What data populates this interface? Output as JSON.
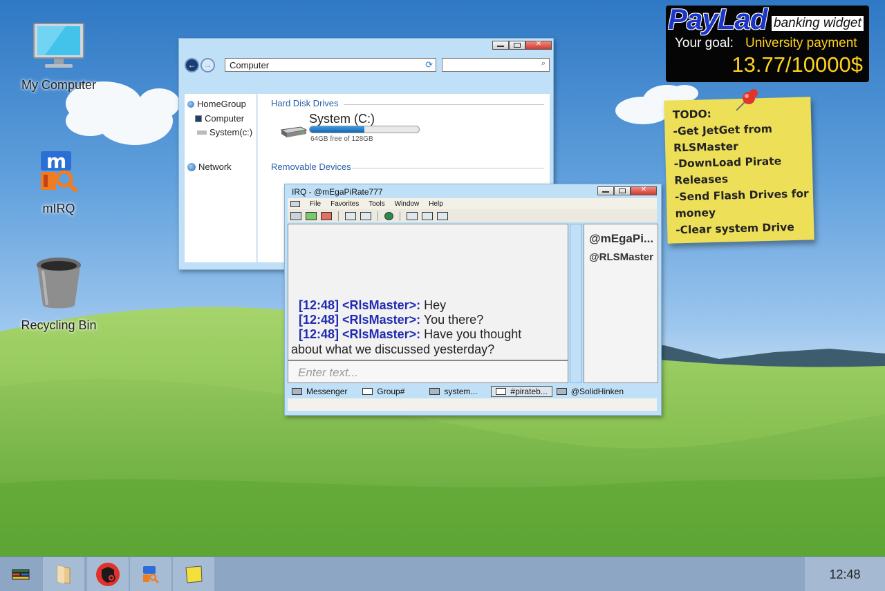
{
  "desktop": {
    "icons": [
      {
        "label": "My Computer",
        "icon": "monitor-icon"
      },
      {
        "label": "mIRQ",
        "icon": "mirq-app-icon"
      },
      {
        "label": "Recycling Bin",
        "icon": "trash-icon"
      }
    ]
  },
  "explorer": {
    "address": "Computer",
    "search_placeholder": "",
    "sidebar": [
      "HomeGroup",
      "Computer",
      "System(c:)",
      "Network"
    ],
    "sections": {
      "hard_disk": "Hard Disk Drives",
      "removable": "Removable Devices"
    },
    "drive": {
      "name": "System (C:)",
      "free_text": "64GB free of 128GB",
      "used_fraction": 0.5
    }
  },
  "chat": {
    "title": "IRQ - @mEgaPiRate777",
    "menu": [
      "File",
      "Favorites",
      "Tools",
      "Window",
      "Help"
    ],
    "messages": [
      {
        "time": "[12:48]",
        "nick": "<RlsMaster>:",
        "text": " Hey"
      },
      {
        "time": "[12:48]",
        "nick": "<RlsMaster>:",
        "text": " You there?"
      },
      {
        "time": "[12:48]",
        "nick": "<RlsMaster>:",
        "text": " Have you thought"
      }
    ],
    "message_continuation": "about what we discussed yesterday?",
    "input_placeholder": "Enter text...",
    "users": [
      "@mEgaPi...",
      "@RLSMaster"
    ],
    "tabs": [
      "Messenger",
      "Group#",
      "system...",
      "#pirateb...",
      "@SolidHinken"
    ],
    "active_tab": "#pirateb..."
  },
  "bank": {
    "brand": "PayLad",
    "subtitle": "banking widget",
    "goal_label": "Your goal:",
    "goal_value": "University payment",
    "amount": "13.77/10000$",
    "accent": "#ffd21f"
  },
  "note": {
    "lines": [
      "TODO:",
      "-Get JetGet from",
      "RLSMaster",
      "-DownLoad Pirate",
      "Releases",
      "-Send Flash Drives for",
      "money",
      "-Clear system Drive"
    ]
  },
  "taskbar": {
    "buttons": [
      "start-icon",
      "folder-icon",
      "shield-icon",
      "mirq-icon",
      "sticky-note-icon"
    ],
    "clock": "12:48"
  }
}
